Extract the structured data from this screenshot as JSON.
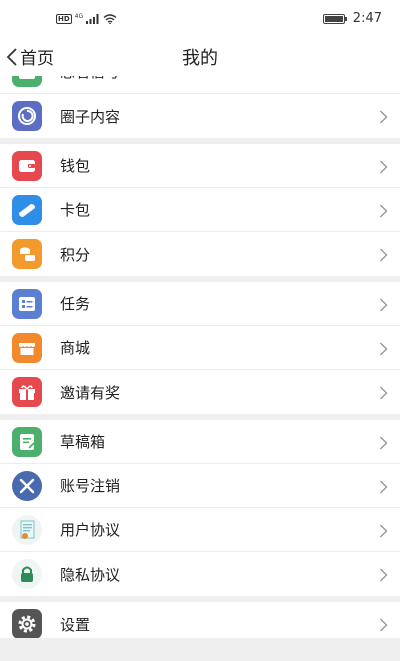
{
  "status_bar": {
    "hd": "HD",
    "network": "4G",
    "time": "2:47",
    "battery_level": 1.0
  },
  "nav": {
    "back_label": "首页",
    "title": "我的"
  },
  "groups": [
    {
      "items": [
        {
          "label": "想看信号",
          "icon": "partial-green-icon",
          "color": "#4caf6d",
          "partial": true
        },
        {
          "label": "圈子内容",
          "icon": "circle-spiral-icon",
          "color": "#5b6ec4"
        }
      ]
    },
    {
      "items": [
        {
          "label": "钱包",
          "icon": "wallet-icon",
          "color": "#e5484d"
        },
        {
          "label": "卡包",
          "icon": "card-icon",
          "color": "#2f8ee6"
        },
        {
          "label": "积分",
          "icon": "coins-icon",
          "color": "#f39a2d"
        }
      ]
    },
    {
      "items": [
        {
          "label": "任务",
          "icon": "task-list-icon",
          "color": "#5b7fd1"
        },
        {
          "label": "商城",
          "icon": "store-icon",
          "color": "#f3892d"
        },
        {
          "label": "邀请有奖",
          "icon": "gift-icon",
          "color": "#e5484d"
        }
      ]
    },
    {
      "items": [
        {
          "label": "草稿箱",
          "icon": "draft-icon",
          "color": "#4caf6d"
        },
        {
          "label": "账号注销",
          "icon": "cancel-account-icon",
          "color": "#4a6ab0"
        },
        {
          "label": "用户协议",
          "icon": "agreement-icon",
          "color": "#7fc4c9"
        },
        {
          "label": "隐私协议",
          "icon": "privacy-lock-icon",
          "color": "#2e8b57"
        }
      ]
    },
    {
      "items": [
        {
          "label": "设置",
          "icon": "gear-icon",
          "color": "#555555"
        }
      ]
    }
  ]
}
